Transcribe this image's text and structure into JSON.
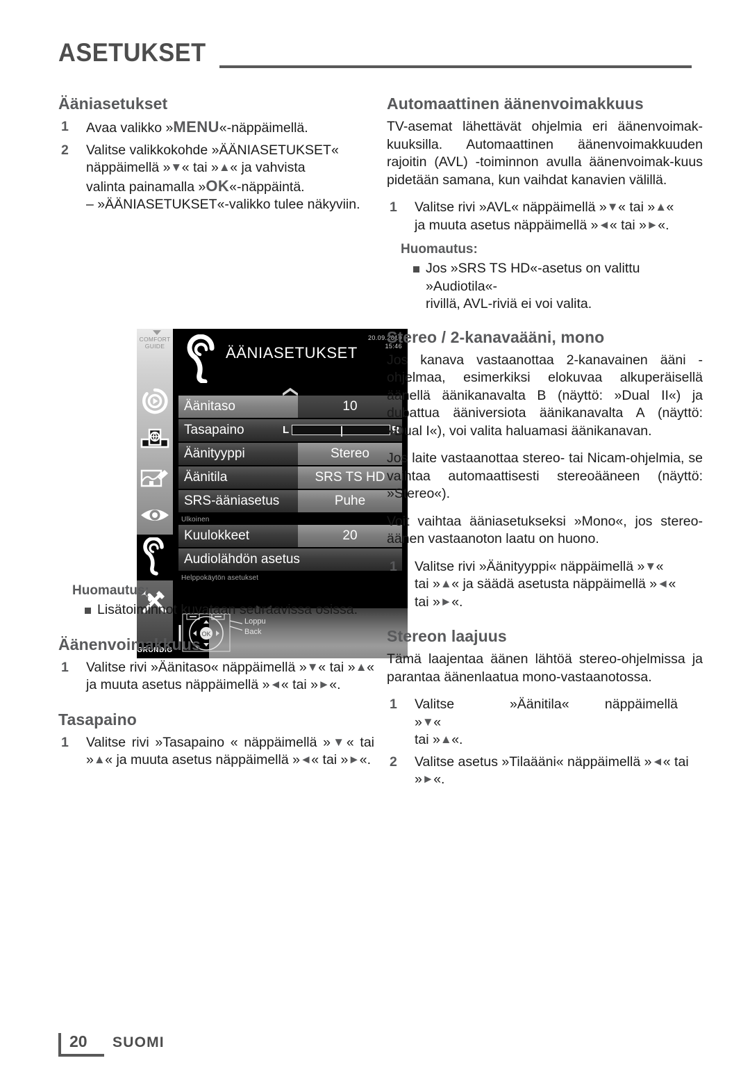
{
  "header": {
    "title": "ASETUKSET"
  },
  "footer": {
    "page_number": "20",
    "language": "SUOMI"
  },
  "left_column": {
    "section1": {
      "heading": "Ääniasetukset",
      "steps": [
        {
          "num": "1",
          "text_before": "Avaa valikko »",
          "key": "MENU",
          "text_after": "«-näppäimellä."
        }
      ],
      "step2": {
        "num": "2",
        "line1": "Valitse valikkokohde »ÄÄNIASETUKSET«",
        "line2_a": "näppäimellä »",
        "line2_k1": "▼",
        "line2_b": "« tai »",
        "line2_k2": "▲",
        "line2_c": "« ja vahvista",
        "line3_a": "valinta painamalla »",
        "line3_k": "OK",
        "line3_b": "«-näppäintä.",
        "line4": "– »ÄÄNIASETUKSET«-valikko tulee näkyviin."
      }
    },
    "note": {
      "heading": "Huomautus:",
      "bullet": "Lisätoiminnot kuvataan seuraavissa osissa."
    },
    "section2": {
      "heading": "Äänenvoimakkuus",
      "step": {
        "num": "1",
        "a": "Valitse rivi »Äänitaso« näppäimellä »",
        "k1": "▼",
        "b": "« tai »",
        "k2": "▲",
        "c": "« ja muuta asetus näppäimellä »",
        "k3": "◄",
        "d": "« tai »",
        "k4": "►",
        "e": "«."
      }
    },
    "section3": {
      "heading": "Tasapaino",
      "step": {
        "num": "1",
        "a": "Valitse rivi »Tasapaino « näppäimellä »",
        "k1": "▼",
        "b": "« tai »",
        "k2": "▲",
        "c": "« ja muuta asetus näppäimellä »",
        "k3": "◄",
        "d": "« tai »",
        "k4": "►",
        "e": "«."
      }
    }
  },
  "right_column": {
    "section1": {
      "heading": "Automaattinen äänenvoimakkuus",
      "body": "TV-asemat lähettävät ohjelmia eri äänenvoimak-kuuksilla. Automaattinen äänenvoimakkuuden rajoitin (AVL) -toiminnon avulla äänenvoimak-kuus pidetään samana, kun vaihdat kanavien välillä.",
      "step": {
        "num": "1",
        "a": "Valitse rivi »AVL« näppäimellä »",
        "k1": "▼",
        "b": "« tai »",
        "k2": "▲",
        "c": "«",
        "line2_a": "ja muuta asetus näppäimellä »",
        "k3": "◄",
        "line2_b": "« tai »",
        "k4": "►",
        "line2_c": "«."
      },
      "note": {
        "heading": "Huomautus:",
        "bullet_line1": "Jos »SRS TS HD«-asetus on valittu »Audiotila«-",
        "bullet_line2": "rivillä, AVL-riviä ei voi valita."
      }
    },
    "section2": {
      "heading": "Stereo / 2-kanavaääni, mono",
      "para1": "Jos kanava vastaanottaa 2-kanavainen ääni -ohjelmaa, esimerkiksi elokuvaa alkuperäisellä äänellä äänikanavalta B (näyttö: »Dual II«) ja dubattua ääniversiota äänikanavalta A (näyttö: »Dual I«), voi valita haluamasi äänikanavan.",
      "para2": "Jos laite vastaanottaa stereo- tai Nicam-ohjelmia, se vaihtaa automaattisesti stereoääneen (näyttö: »Stereo«).",
      "para3": "Voit vaihtaa ääniasetukseksi »Mono«, jos stereo-äänen vastaanoton laatu on huono.",
      "step": {
        "num": "1",
        "a": "Valitse rivi »Äänityyppi« näppäimellä »",
        "k1": "▼",
        "b": "«",
        "line2_a": "tai »",
        "k2": "▲",
        "line2_b": "« ja säädä asetusta näppäimellä »",
        "k3": "◄",
        "line2_c": "«",
        "line3_a": "tai »",
        "k4": "►",
        "line3_b": "«."
      }
    },
    "section3": {
      "heading": "Stereon laajuus",
      "body": "Tämä laajentaa äänen lähtöä stereo-ohjelmissa ja parantaa äänenlaatua mono-vastaanotossa.",
      "step1": {
        "num": "1",
        "a": "Valitse",
        "b": "»Äänitila«",
        "c": "näppäimellä",
        "d": "»",
        "k1": "▼",
        "e": "«",
        "line2_a": "tai »",
        "k2": "▲",
        "line2_b": "«."
      },
      "step2": {
        "num": "2",
        "a": "Valitse asetus »Tilaääni« näppäimellä »",
        "k1": "◄",
        "b": "« tai »",
        "k2": "►",
        "c": "«."
      }
    }
  },
  "tv_figure": {
    "comfort_guide_label_line1": "COMFORT",
    "comfort_guide_label_line2": "GUIDE",
    "brand": "GRUNDIG",
    "menu_title": "ÄÄNIASETUKSET",
    "date": "20.09.2010",
    "time": "15:46",
    "rows": [
      {
        "label": "Äänitaso",
        "value": "10",
        "selected": true,
        "type": "value"
      },
      {
        "label": "Tasapaino",
        "value": "",
        "selected": false,
        "type": "balance",
        "left_mark": "L",
        "right_mark": "R"
      },
      {
        "label": "Äänityyppi",
        "value": "Stereo",
        "selected": false,
        "type": "value"
      },
      {
        "label": "Äänitila",
        "value": "SRS TS HD",
        "selected": false,
        "type": "value"
      },
      {
        "label": "SRS-ääniasetus",
        "value": "Puhe",
        "selected": false,
        "type": "value"
      }
    ],
    "group_label_external": "Ulkoinen",
    "rows2": [
      {
        "label": "Kuulokkeet",
        "value": "20",
        "selected": false,
        "type": "value"
      },
      {
        "label": "Audiolähdön asetus",
        "value": "",
        "selected": false,
        "type": "full"
      }
    ],
    "group_label_easy": "Helppokäytön asetukset",
    "nav_hint_line1": "Loppu",
    "nav_hint_line2": "Back",
    "ok_label": "OK"
  },
  "colors": {
    "heading_gray": "#58595b",
    "rule_gray": "#595959",
    "body_black": "#1b1b1b"
  }
}
